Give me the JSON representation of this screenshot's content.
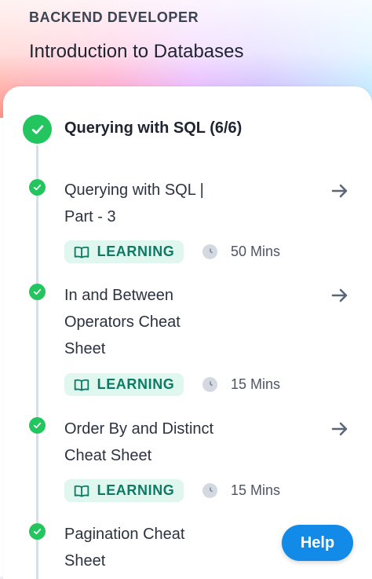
{
  "header": {
    "role": "BACKEND DEVELOPER",
    "course": "Introduction to Databases"
  },
  "section": {
    "title": "Querying with SQL (6/6)"
  },
  "items": [
    {
      "title": "Querying with SQL |\nPart - 3",
      "badge": "LEARNING",
      "duration": "50 Mins"
    },
    {
      "title": "In and Between\nOperators Cheat\nSheet",
      "badge": "LEARNING",
      "duration": "15 Mins"
    },
    {
      "title": "Order By and Distinct\nCheat Sheet",
      "badge": "LEARNING",
      "duration": "15 Mins"
    },
    {
      "title": "Pagination Cheat\nSheet"
    }
  ],
  "help": {
    "label": "Help"
  },
  "icons": {
    "check": "check-icon",
    "arrow": "arrow-right-icon",
    "book": "book-icon",
    "clock": "clock-icon"
  },
  "colors": {
    "accent_green": "#22c55e",
    "badge_bg": "#dff7ef",
    "badge_text": "#0f7a63",
    "help_blue": "#118ae8"
  }
}
